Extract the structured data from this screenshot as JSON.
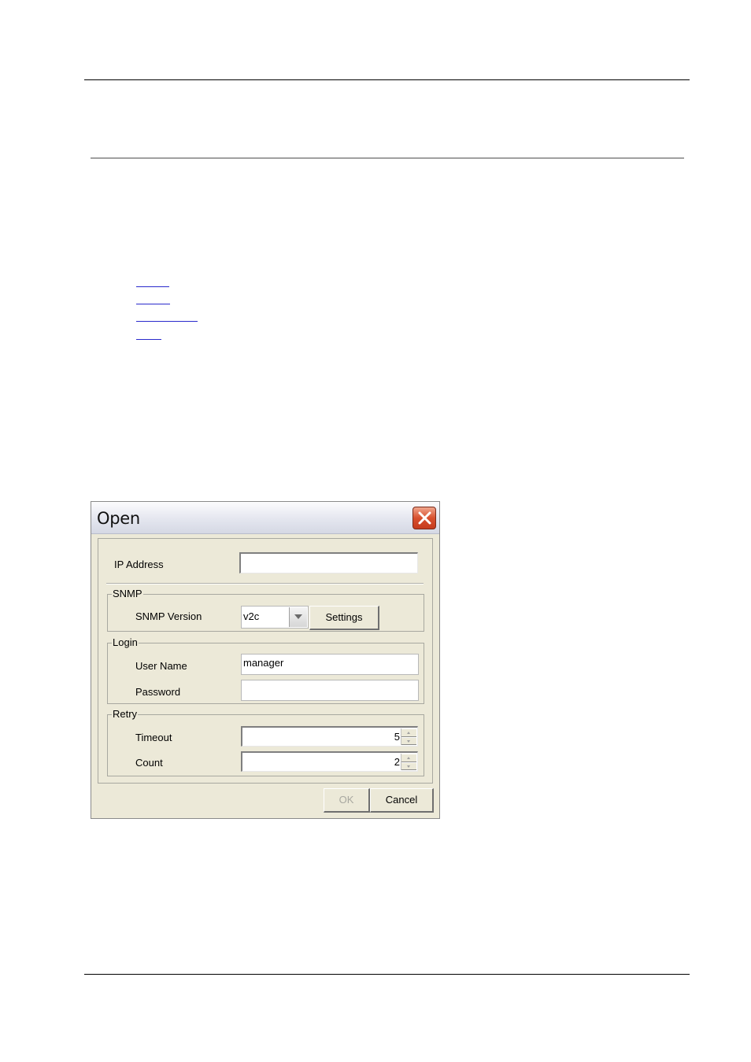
{
  "dialog": {
    "title": "Open",
    "ip_address": {
      "label": "IP Address",
      "value": ""
    },
    "snmp": {
      "group_label": "SNMP",
      "version_label": "SNMP Version",
      "version_value": "v2c",
      "settings_label": "Settings"
    },
    "login": {
      "group_label": "Login",
      "user_name_label": "User Name",
      "user_name_value": "manager",
      "password_label": "Password",
      "password_value": ""
    },
    "retry": {
      "group_label": "Retry",
      "timeout_label": "Timeout",
      "timeout_value": "5",
      "count_label": "Count",
      "count_value": "2"
    },
    "buttons": {
      "ok": "OK",
      "cancel": "Cancel"
    }
  },
  "colors": {
    "dialog_bg": "#ece9d8",
    "close_button": "#d8502e",
    "link_underline": "#2a2acc"
  }
}
